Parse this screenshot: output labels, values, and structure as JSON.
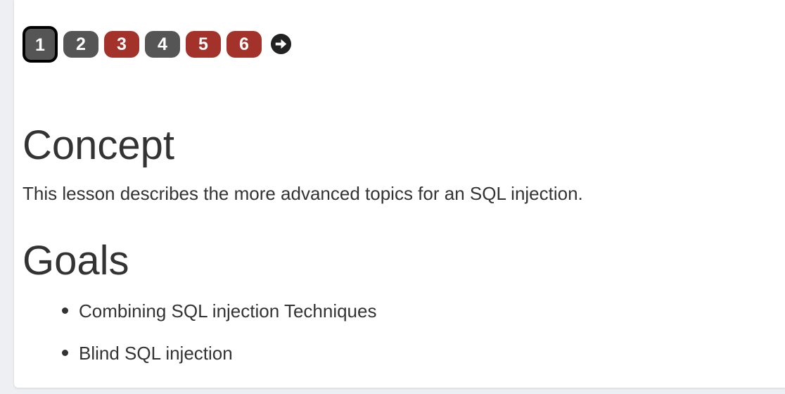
{
  "pagination": {
    "pages": [
      {
        "label": "1",
        "status": "current",
        "color": "#555555"
      },
      {
        "label": "2",
        "status": "neutral",
        "color": "#555555"
      },
      {
        "label": "3",
        "status": "incomplete",
        "color": "#a3332a"
      },
      {
        "label": "4",
        "status": "neutral",
        "color": "#555555"
      },
      {
        "label": "5",
        "status": "incomplete",
        "color": "#a3332a"
      },
      {
        "label": "6",
        "status": "incomplete",
        "color": "#a3332a"
      }
    ],
    "next_icon": "arrow-right-circle-icon"
  },
  "lesson": {
    "concept_heading": "Concept",
    "concept_text": "This lesson describes the more advanced topics for an SQL injection.",
    "goals_heading": "Goals",
    "goals": [
      "Combining SQL injection Techniques",
      "Blind SQL injection"
    ]
  }
}
